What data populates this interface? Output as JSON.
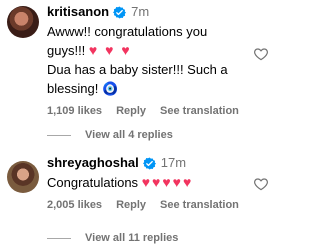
{
  "comments": [
    {
      "username": "kritisanon",
      "time": "7m",
      "lines": [
        "Awww!! congratulations you",
        "guys!!!",
        "Dua has a baby sister!!! Such a",
        "blessing!"
      ],
      "line2_emoji": "♥ ♥ ♥",
      "line4_emoji": "🧿",
      "likes": "1,109 likes",
      "reply_label": "Reply",
      "translation_label": "See translation",
      "view_replies": "View all 4 replies"
    },
    {
      "username": "shreyaghoshal",
      "time": "17m",
      "text": "Congratulations",
      "emoji": "♥♥♥♥♥",
      "likes": "2,005 likes",
      "reply_label": "Reply",
      "translation_label": "See translation",
      "view_replies": "View all 11 replies"
    }
  ],
  "icons": {
    "verified": "verified-badge-icon",
    "like": "heart-outline-icon"
  },
  "colors": {
    "verified": "#0095f6",
    "heart_emoji": "#f2345f",
    "muted_text": "#737373"
  }
}
